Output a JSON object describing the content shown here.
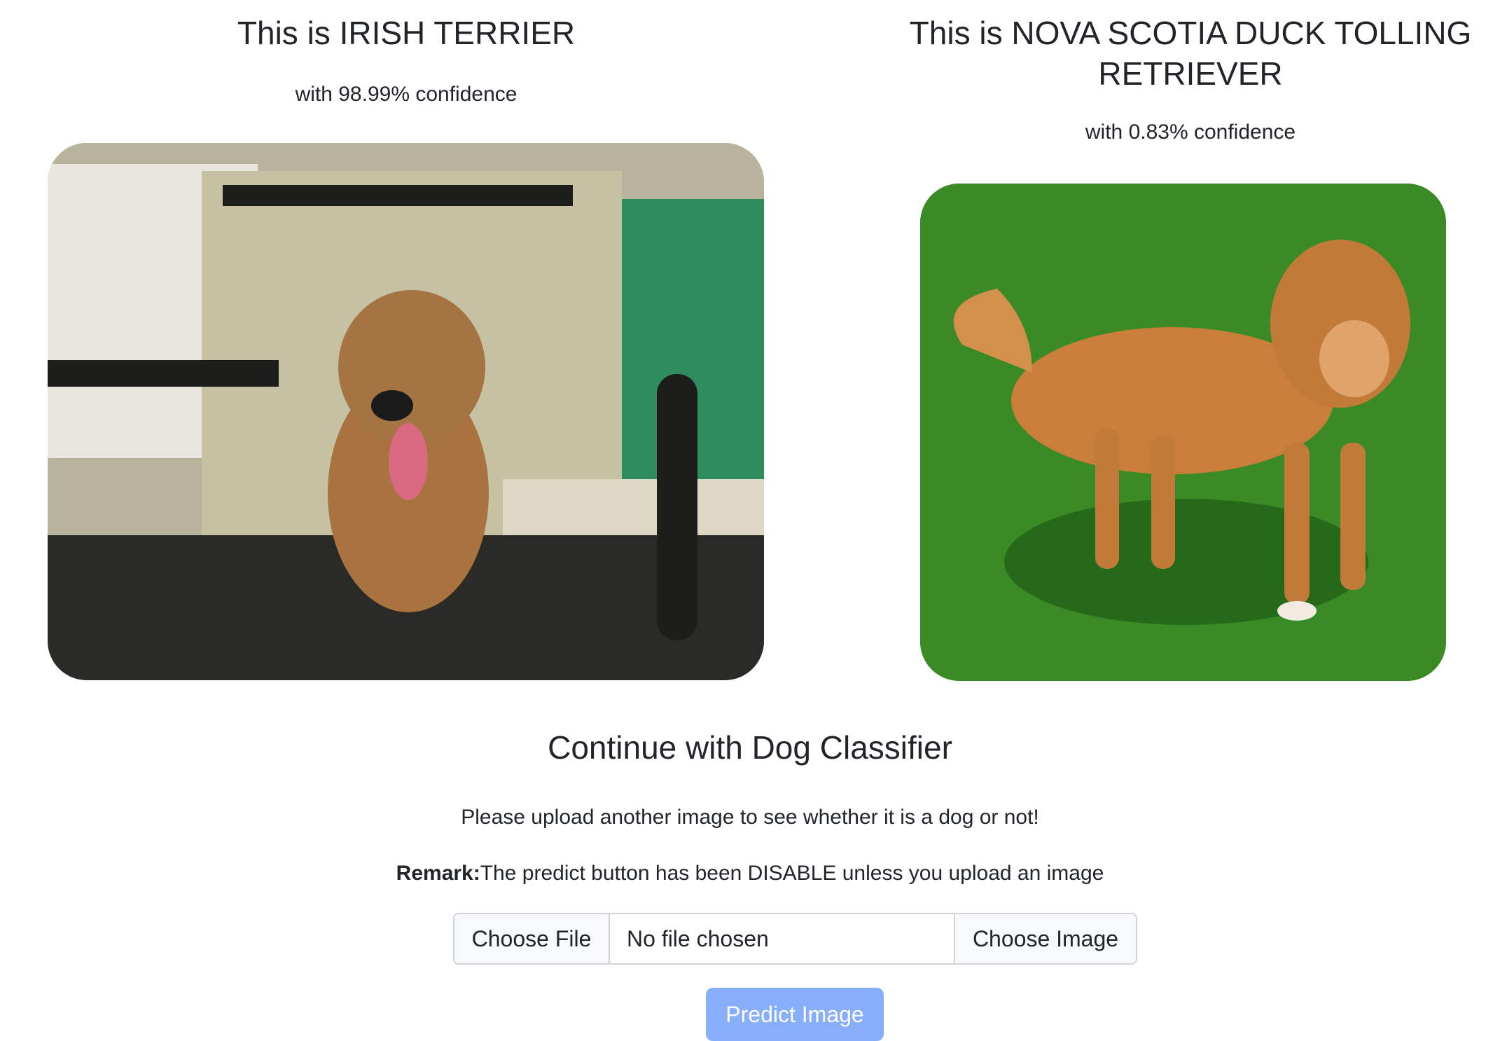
{
  "results": [
    {
      "title": "This is IRISH TERRIER",
      "confidence": "with 98.99% confidence"
    },
    {
      "title": "This is NOVA SCOTIA DUCK TOLLING RETRIEVER",
      "confidence": "with 0.83% confidence"
    }
  ],
  "continue": {
    "heading": "Continue with Dog Classifier",
    "subtitle": "Please upload another image to see whether it is a dog or not!",
    "remark_label": "Remark:",
    "remark_text": "The predict button has been DISABLE unless you upload an image"
  },
  "upload": {
    "choose_file_label": "Choose File",
    "file_status": "No file chosen",
    "choose_image_label": "Choose Image"
  },
  "predict_button": {
    "label": "Predict Image",
    "enabled": false
  },
  "colors": {
    "predict_button": "#86aefa",
    "text": "#212529",
    "border": "#ced4da"
  }
}
